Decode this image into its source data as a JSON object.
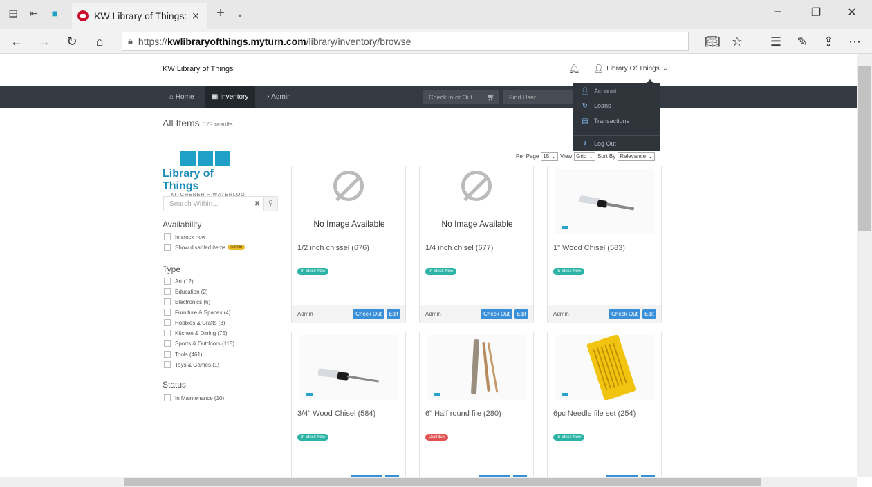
{
  "browser": {
    "tab_title": "KW Library of Things: In",
    "url_scheme": "https://",
    "url_host": "kwlibraryofthings.myturn.com",
    "url_path": "/library/inventory/browse"
  },
  "header": {
    "site_name": "KW Library of Things",
    "user_label": "Library Of Things"
  },
  "nav": {
    "home": "Home",
    "inventory": "Inventory",
    "admin": "Admin",
    "checkin_placeholder": "Check In or Out",
    "finduser_placeholder": "Find User"
  },
  "user_dropdown": {
    "items": [
      "Account",
      "Loans",
      "Transactions",
      "Log Out"
    ]
  },
  "results": {
    "title": "All Items",
    "count": "679 results"
  },
  "logo": {
    "title": "Library of Things",
    "subtitle": "KITCHENER ~ WATERLOO"
  },
  "search": {
    "placeholder": "Search Within..."
  },
  "filters": {
    "availability_label": "Availability",
    "availability": [
      "In stock now",
      "Show disabled items"
    ],
    "admin_badge": "Admin",
    "type_label": "Type",
    "types": [
      "Art (12)",
      "Education (2)",
      "Electronics (6)",
      "Furniture & Spaces (4)",
      "Hobbies & Crafts (3)",
      "Kitchen & Dining (75)",
      "Sports & Outdoors (115)",
      "Tools (461)",
      "Toys & Games (1)"
    ],
    "status_label": "Status",
    "status": [
      "In Maintenance (10)"
    ]
  },
  "toolbar": {
    "per_page_label": "Per Page",
    "per_page_value": "15",
    "view_label": "View",
    "view_value": "Grid",
    "sort_label": "Sort By",
    "sort_value": "Relevance"
  },
  "no_image_text": "No Image Available",
  "card_labels": {
    "admin": "Admin",
    "checkout": "Check Out",
    "edit": "Edit"
  },
  "items": [
    {
      "title": "1/2 inch chissel (676)",
      "status": "In Stock Now"
    },
    {
      "title": "1/4 inch chisel (677)",
      "status": "In Stock Now"
    },
    {
      "title": "1\" Wood Chisel (583)",
      "status": "In Stock Now"
    },
    {
      "title": "3/4\" Wood Chisel (584)",
      "status": "In Stock Now"
    },
    {
      "title": "6\" Half round file (280)",
      "status": "Overdue"
    },
    {
      "title": "6pc Needle file set (254)",
      "status": "In Stock Now"
    }
  ]
}
